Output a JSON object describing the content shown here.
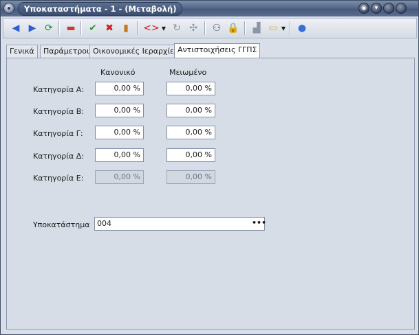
{
  "window": {
    "title": "Υποκαταστήματα - 1 - (Μεταβολή)"
  },
  "titlebar_buttons": [
    {
      "name": "roll-up-icon",
      "glyph": "◉"
    },
    {
      "name": "minimize-icon",
      "glyph": "▾"
    },
    {
      "name": "maximize-icon",
      "glyph": ""
    },
    {
      "name": "close-icon",
      "glyph": ""
    }
  ],
  "toolbar": {
    "icons": [
      {
        "name": "previous-record-icon",
        "glyph": "◀",
        "color": "#2f5fd0"
      },
      {
        "name": "next-record-icon",
        "glyph": "▶",
        "color": "#2f5fd0"
      },
      {
        "name": "refresh-icon",
        "glyph": "⟳",
        "color": "#1f8f3a"
      },
      {
        "name": "delete-record-icon",
        "glyph": "▬",
        "color": "#d03a2a"
      },
      {
        "name": "save-check-icon",
        "glyph": "✔",
        "color": "#2f9a2f"
      },
      {
        "name": "cancel-x-icon",
        "glyph": "✖",
        "color": "#d02020"
      },
      {
        "name": "exit-door-icon",
        "glyph": "▮",
        "color": "#c07a20"
      },
      {
        "name": "code-tags-icon",
        "glyph": "<>",
        "color": "#c02020"
      },
      {
        "name": "history-icon",
        "glyph": "↻",
        "color": "#8a95a6"
      },
      {
        "name": "puzzle-icon",
        "glyph": "✣",
        "color": "#8a95a6"
      },
      {
        "name": "binoculars-icon",
        "glyph": "⚇",
        "color": "#4a5670"
      },
      {
        "name": "lock-icon",
        "glyph": "🔒",
        "color": "#c6a040"
      },
      {
        "name": "stamp-icon",
        "glyph": "▟",
        "color": "#8a95a6"
      },
      {
        "name": "note-icon",
        "glyph": "▭",
        "color": "#d8b020"
      },
      {
        "name": "user-globe-icon",
        "glyph": "●",
        "color": "#3a6fd8"
      }
    ]
  },
  "tabs": [
    {
      "label": "Γενικά",
      "active": false
    },
    {
      "label": "Παράμετροι",
      "active": false
    },
    {
      "label": "Οικονομικές Ιεραρχίες",
      "active": false
    },
    {
      "label": "Αντιστοιχήσεις ΓΓΠΣ",
      "active": true
    }
  ],
  "form": {
    "col_normal": "Κανονικό",
    "col_reduced": "Μειωμένο",
    "rows": [
      {
        "label": "Κατηγορία Α:",
        "normal": "0,00 %",
        "reduced": "0,00 %",
        "enabled": true
      },
      {
        "label": "Κατηγορία Β:",
        "normal": "0,00 %",
        "reduced": "0,00 %",
        "enabled": true
      },
      {
        "label": "Κατηγορία Γ:",
        "normal": "0,00 %",
        "reduced": "0,00 %",
        "enabled": true
      },
      {
        "label": "Κατηγορία Δ:",
        "normal": "0,00 %",
        "reduced": "0,00 %",
        "enabled": true
      },
      {
        "label": "Κατηγορία Ε:",
        "normal": "0,00 %",
        "reduced": "0,00 %",
        "enabled": false
      }
    ],
    "branch_label": "Υποκατάστημα",
    "branch_value": "004",
    "lookup_glyph": "•••"
  }
}
